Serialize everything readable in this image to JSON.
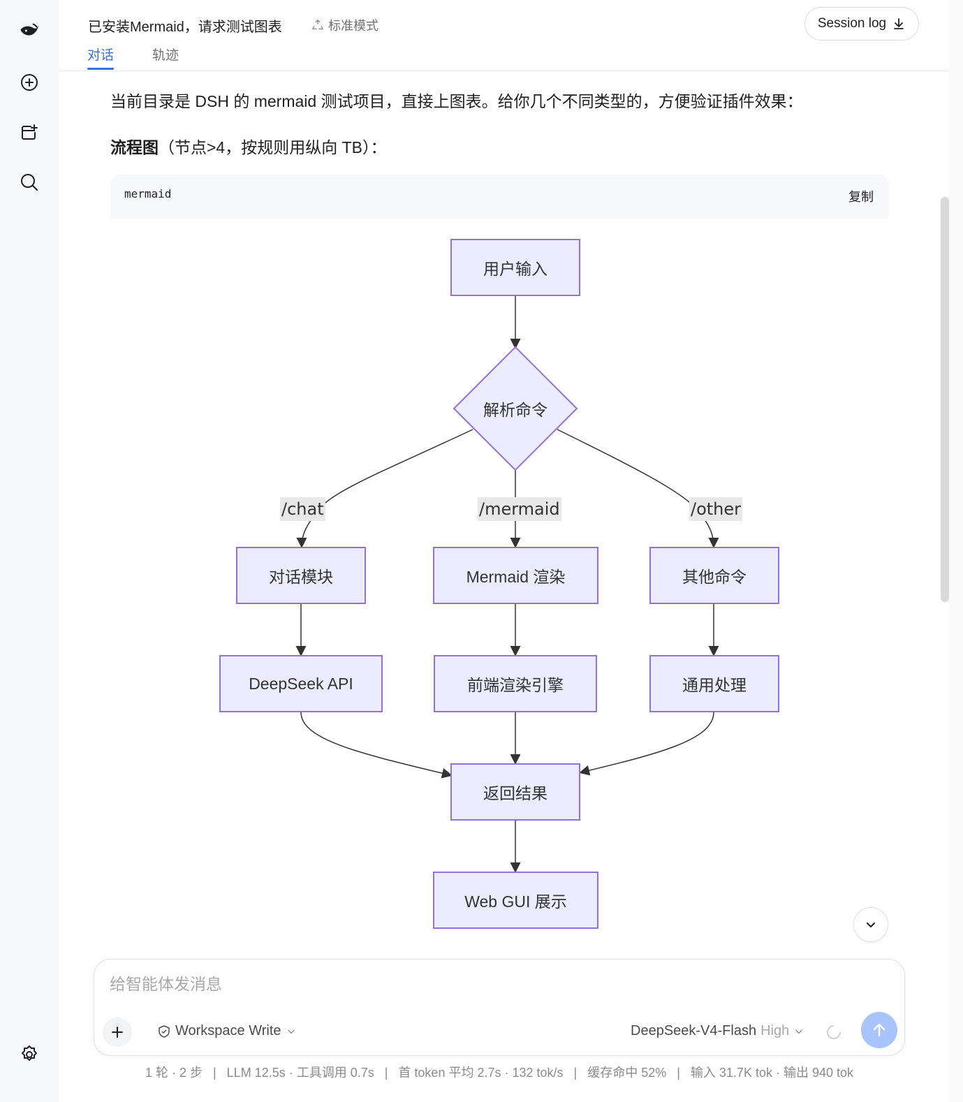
{
  "header": {
    "title": "已安装Mermaid，请求测试图表",
    "mode": "标准模式",
    "session_button": "Session log",
    "tabs": [
      "对话",
      "轨迹"
    ]
  },
  "message": {
    "intro": "当前目录是 DSH 的 mermaid 测试项目，直接上图表。给你几个不同类型的，方便验证插件效果：",
    "section_bold": "流程图",
    "section_rest": "（节点>4，按规则用纵向 TB）："
  },
  "code_block": {
    "language": "mermaid",
    "copy_label": "复制"
  },
  "flowchart": {
    "nodes": {
      "input": "用户输入",
      "parse": "解析命令",
      "chat_module": "对话模块",
      "mermaid_render": "Mermaid 渲染",
      "other_cmd": "其他命令",
      "deepseek_api": "DeepSeek API",
      "frontend_engine": "前端渲染引擎",
      "generic": "通用处理",
      "result": "返回结果",
      "webgui": "Web GUI 展示"
    },
    "edge_labels": {
      "chat": "/chat",
      "mermaid": "/mermaid",
      "other": "/other"
    }
  },
  "composer": {
    "placeholder": "给智能体发消息",
    "workspace": "Workspace Write",
    "model": "DeepSeek-V4-Flash",
    "effort": "High"
  },
  "stats": "1 轮 · 2 步   |   LLM 12.5s · 工具调用 0.7s   |   首 token 平均 2.7s · 132 tok/s   |   缓存命中 52%   |   输入 31.7K tok · 输出 940 tok",
  "colors": {
    "accent": "#3b6fe0",
    "node_fill": "#ececff",
    "node_stroke": "#9370db",
    "send_button": "#a9c3fb"
  },
  "icons": {
    "logo": "whale-logo-icon",
    "new_chat": "plus-circle-icon",
    "new_tab": "add-window-icon",
    "search": "search-icon",
    "settings": "gear-icon"
  }
}
